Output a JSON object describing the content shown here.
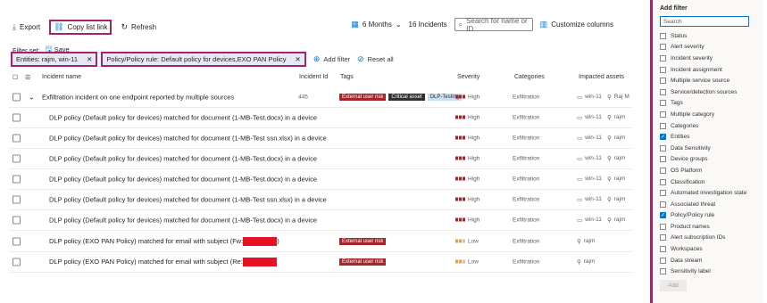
{
  "toolbar": {
    "export": "Export",
    "copy_link": "Copy list link",
    "refresh": "Refresh",
    "time_range": "6 Months",
    "incident_count": "16 Incidents",
    "search_placeholder": "Search for name or ID",
    "customize": "Customize columns"
  },
  "filter_set": {
    "label": "Filter set:",
    "save": "Save"
  },
  "chips": [
    {
      "label": "Entities: rajm, win-11"
    },
    {
      "label": "Policy/Policy rule: Default policy for devices,EXO PAN Policy"
    }
  ],
  "add_filter": "Add filter",
  "reset_all": "Reset all",
  "columns": [
    "Incident name",
    "Incident Id",
    "Tags",
    "Severity",
    "Categories",
    "Impacted assets"
  ],
  "rows": [
    {
      "name": "Exfiltration incident on one endpoint reported by multiple sources",
      "id": "445",
      "tags": [
        "External user risk",
        "Critical asset",
        "DLP-Testing"
      ],
      "severity": "High",
      "category": "Exfiltration",
      "asset1": "win-11",
      "asset2": "Raj M",
      "parent": true
    },
    {
      "name": "DLP policy (Default policy for devices) matched for document (1-MB-Test.docx) in a device",
      "severity": "High",
      "category": "Exfiltration",
      "asset1": "win-11",
      "asset2": "rajm"
    },
    {
      "name": "DLP policy (Default policy for devices) matched for document (1-MB-Test ssn.xlsx) in a device",
      "severity": "High",
      "category": "Exfiltration",
      "asset1": "win-11",
      "asset2": "rajm"
    },
    {
      "name": "DLP policy (Default policy for devices) matched for document (1-MB-Test.docx) in a device",
      "severity": "High",
      "category": "Exfiltration",
      "asset1": "win-11",
      "asset2": "rajm"
    },
    {
      "name": "DLP policy (Default policy for devices) matched for document (1-MB-Test.docx) in a device",
      "severity": "High",
      "category": "Exfiltration",
      "asset1": "win-11",
      "asset2": "rajm"
    },
    {
      "name": "DLP policy (Default policy for devices) matched for document (1-MB-Test ssn.xlsx) in a device",
      "severity": "High",
      "category": "Exfiltration",
      "asset1": "win-11",
      "asset2": "rajm"
    },
    {
      "name": "DLP policy (Default policy for devices) matched for document (1-MB-Test.docx) in a device",
      "severity": "High",
      "category": "Exfiltration",
      "asset1": "win-11",
      "asset2": "rajm"
    },
    {
      "name": "DLP policy (EXO PAN Policy) matched for email with subject (Fw:",
      "tail": ")",
      "tags": [
        "External user risk"
      ],
      "severity": "Low",
      "category": "Exfiltration",
      "asset1": "rajm"
    },
    {
      "name": "DLP policy (EXO PAN Policy) matched for email with subject (Re:",
      "tail": "",
      "tags": [
        "External user risk"
      ],
      "severity": "Low",
      "category": "Exfiltration",
      "asset1": "rajm"
    }
  ],
  "tag_colors": {
    "External user risk": "#a4262c",
    "Critical asset": "#323130",
    "DLP-Testing": "#c7e0f4"
  },
  "panel": {
    "title": "Add filter",
    "search": "Search",
    "items": [
      {
        "label": "Status",
        "checked": false
      },
      {
        "label": "Alert severity",
        "checked": false
      },
      {
        "label": "Incident severity",
        "checked": false
      },
      {
        "label": "Incident assignment",
        "checked": false
      },
      {
        "label": "Multiple service source",
        "checked": false
      },
      {
        "label": "Service/detection sources",
        "checked": false
      },
      {
        "label": "Tags",
        "checked": false
      },
      {
        "label": "Multiple category",
        "checked": false
      },
      {
        "label": "Categories",
        "checked": false
      },
      {
        "label": "Entities",
        "checked": true
      },
      {
        "label": "Data Sensitivity",
        "checked": false
      },
      {
        "label": "Device groups",
        "checked": false
      },
      {
        "label": "OS Platform",
        "checked": false
      },
      {
        "label": "Classification",
        "checked": false
      },
      {
        "label": "Automated investigation state",
        "checked": false
      },
      {
        "label": "Associated threat",
        "checked": false
      },
      {
        "label": "Policy/Policy rule",
        "checked": true
      },
      {
        "label": "Product names",
        "checked": false
      },
      {
        "label": "Alert subscription IDs",
        "checked": false
      },
      {
        "label": "Workspaces",
        "checked": false
      },
      {
        "label": "Data stream",
        "checked": false
      },
      {
        "label": "Sensitivity label",
        "checked": false
      }
    ],
    "add": "Add"
  }
}
